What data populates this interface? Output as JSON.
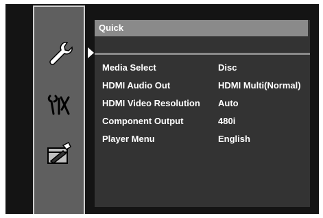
{
  "menu": {
    "title": "Quick",
    "sidebar": [
      {
        "icon": "wrench-icon",
        "selected": true
      },
      {
        "icon": "tools-icon",
        "selected": false
      },
      {
        "icon": "disc-editing-icon",
        "selected": false
      }
    ],
    "settings": [
      {
        "label": "Media Select",
        "value": "Disc"
      },
      {
        "label": "HDMI Audio Out",
        "value": "HDMI Multi(Normal)"
      },
      {
        "label": "HDMI Video Resolution",
        "value": "Auto"
      },
      {
        "label": "Component Output",
        "value": "480i"
      },
      {
        "label": "Player Menu",
        "value": "English"
      }
    ]
  },
  "colors": {
    "panel": "#141414",
    "sidebar": "#5f5f5f",
    "content": "#333333",
    "title_bar": "#8a8a8a",
    "text": "#ffffff"
  }
}
